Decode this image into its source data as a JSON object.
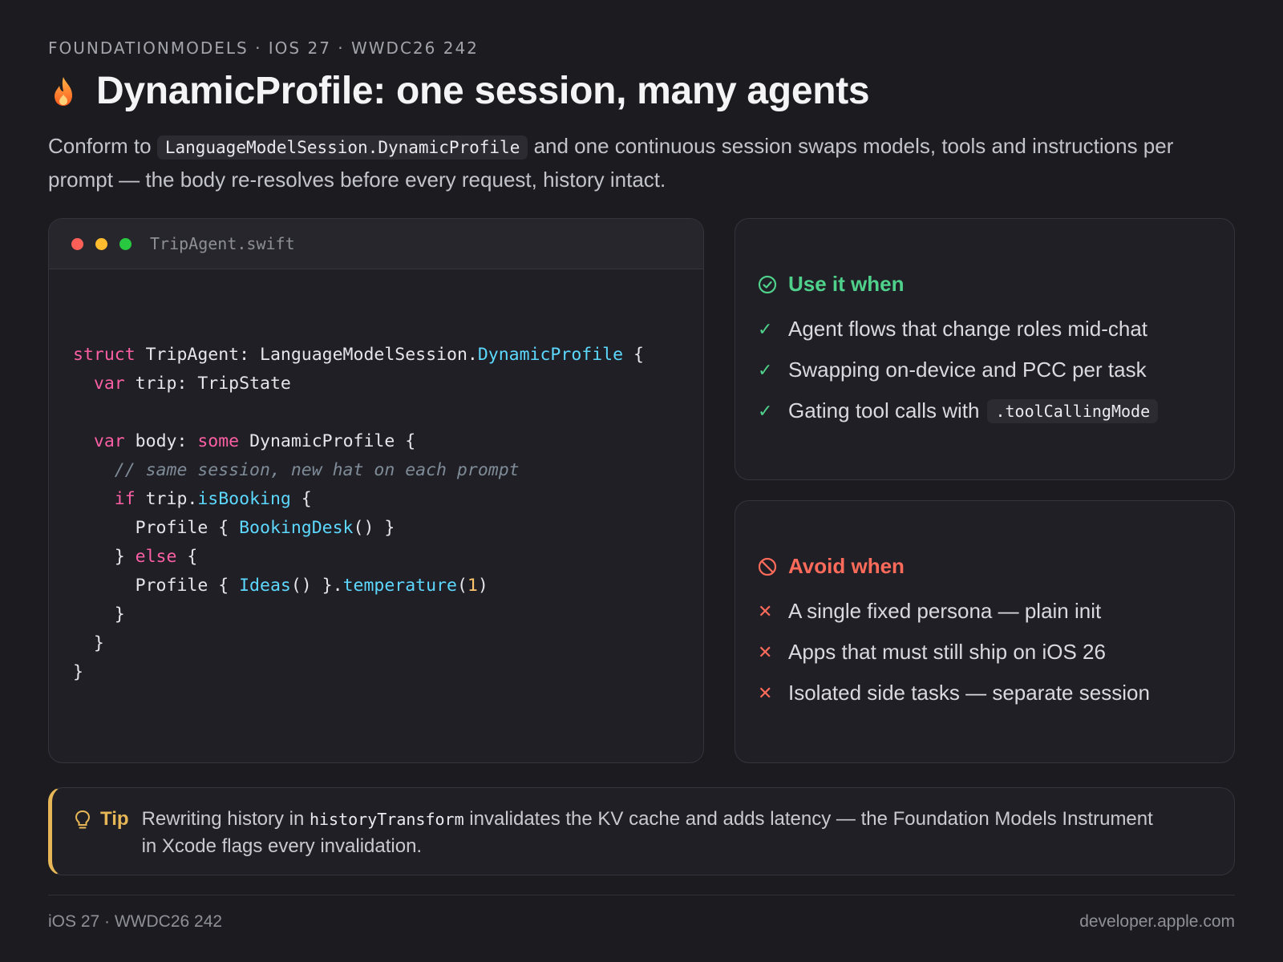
{
  "header": {
    "eyebrow": "FOUNDATIONMODELS · IOS 27 · WWDC26 242",
    "title": "DynamicProfile: one session, many agents",
    "subtitle_before": "Conform to ",
    "subtitle_code": "LanguageModelSession.DynamicProfile",
    "subtitle_after": " and one continuous session swaps models, tools and instructions per prompt — the body re-resolves before every request, history intact.",
    "icon": "flame-icon"
  },
  "code_card": {
    "filename": "TripAgent.swift",
    "window_controls": [
      "close",
      "minimize",
      "zoom"
    ],
    "lines": [
      [
        {
          "t": "struct",
          "c": "kw"
        },
        {
          "t": " TripAgent: LanguageModelSession."
        },
        {
          "t": "DynamicProfile",
          "c": "ty"
        },
        {
          "t": " {"
        }
      ],
      [
        {
          "t": "  "
        },
        {
          "t": "var",
          "c": "kw"
        },
        {
          "t": " trip: TripState"
        }
      ],
      [],
      [
        {
          "t": "  "
        },
        {
          "t": "var",
          "c": "kw"
        },
        {
          "t": " body: "
        },
        {
          "t": "some",
          "c": "kw"
        },
        {
          "t": " DynamicProfile {"
        }
      ],
      [
        {
          "t": "    "
        },
        {
          "t": "// same session, new hat on each prompt",
          "c": "cm"
        }
      ],
      [
        {
          "t": "    "
        },
        {
          "t": "if",
          "c": "kw"
        },
        {
          "t": " trip."
        },
        {
          "t": "isBooking",
          "c": "ty"
        },
        {
          "t": " {"
        }
      ],
      [
        {
          "t": "      Profile { "
        },
        {
          "t": "BookingDesk",
          "c": "ty"
        },
        {
          "t": "() }"
        }
      ],
      [
        {
          "t": "    } "
        },
        {
          "t": "else",
          "c": "kw"
        },
        {
          "t": " {"
        }
      ],
      [
        {
          "t": "      Profile { "
        },
        {
          "t": "Ideas",
          "c": "ty"
        },
        {
          "t": "() }."
        },
        {
          "t": "temperature",
          "c": "ty"
        },
        {
          "t": "("
        },
        {
          "t": "1",
          "c": "num"
        },
        {
          "t": ")"
        }
      ],
      [
        {
          "t": "    }"
        }
      ],
      [
        {
          "t": "  }"
        }
      ],
      [
        {
          "t": "}"
        }
      ]
    ]
  },
  "use_card": {
    "heading": "Use it when",
    "icon": "check-circle-icon",
    "items": [
      {
        "text": "Agent flows that change roles mid-chat",
        "code": ""
      },
      {
        "text": "Swapping on-device and PCC per task",
        "code": ""
      },
      {
        "text": "Gating tool calls with",
        "code": ".toolCallingMode"
      }
    ],
    "color": "#4fd18b"
  },
  "avoid_card": {
    "heading": "Avoid when",
    "icon": "prohibited-icon",
    "items": [
      {
        "text": "A single fixed persona — plain init"
      },
      {
        "text": "Apps that must still ship on iOS 26"
      },
      {
        "text": "Isolated side tasks — separate session"
      }
    ],
    "color": "#ff6b5b"
  },
  "tip": {
    "label": "Tip",
    "icon": "lightbulb-icon",
    "text_before": "Rewriting history in ",
    "code": "historyTransform",
    "text_after": " invalidates the KV cache and adds latency — the Foundation Models Instrument in Xcode flags every invalidation.",
    "color": "#e6b657"
  },
  "footer": {
    "left": "iOS 27 · WWDC26 242",
    "right": "developer.apple.com"
  }
}
